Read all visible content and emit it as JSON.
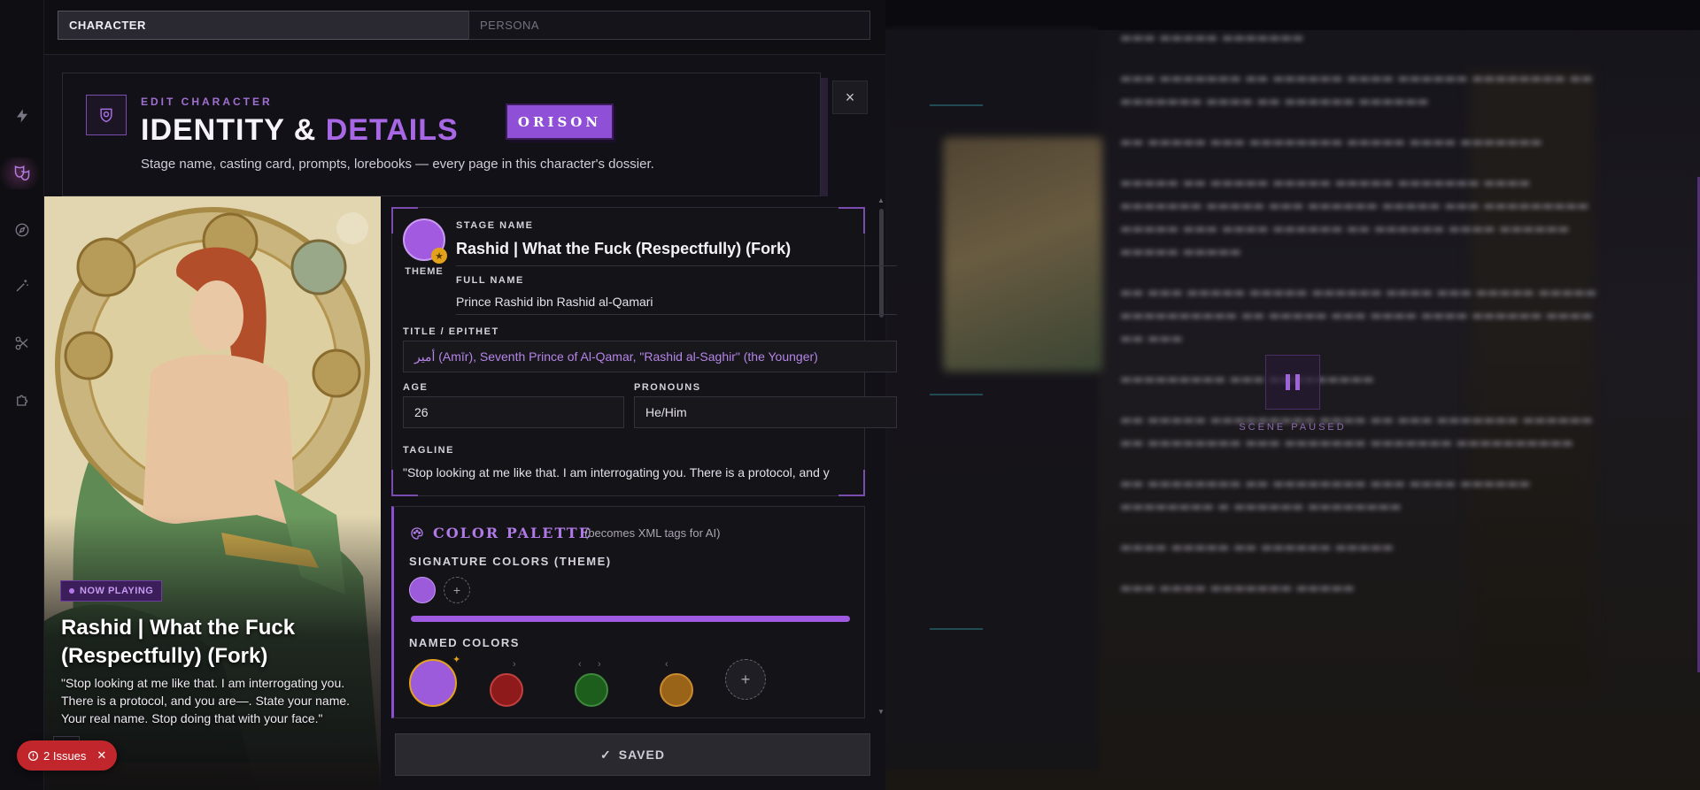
{
  "tabs": [
    {
      "label": "CHARACTER",
      "active": true
    },
    {
      "label": "PERSONA",
      "active": false
    }
  ],
  "header": {
    "kicker": "EDIT CHARACTER",
    "title_main": "IDENTITY &",
    "title_accent": "DETAILS",
    "badge": "ORISON",
    "subtitle": "Stage name, casting card, prompts, lorebooks — every page in this character's dossier.",
    "close_label": "×"
  },
  "rail": {
    "icons": [
      "lightning-icon",
      "theater-masks-icon",
      "compass-icon",
      "magic-wand-icon",
      "scissors-icon",
      "puzzle-icon"
    ],
    "active": "theater-masks-icon"
  },
  "portrait": {
    "now_playing": "NOW PLAYING",
    "name": "Rashid | What the Fuck (Respectfully) (Fork)",
    "quote": "\"Stop looking at me like that. I am interrogating you. There is a protocol, and you are—. State your name. Your real name. Stop doing that with your face.\""
  },
  "identity": {
    "theme_label": "THEME",
    "stage_name_label": "STAGE NAME",
    "stage_name": "Rashid | What the Fuck (Respectfully) (Fork)",
    "full_name_label": "FULL NAME",
    "full_name": "Prince Rashid ibn Rashid al-Qamari",
    "title_label": "TITLE / EPITHET",
    "title_value": "أمير (Amīr), Seventh Prince of Al-Qamar, \"Rashid al-Saghir\" (the Younger)",
    "age_label": "AGE",
    "age": "26",
    "pronouns_label": "PRONOUNS",
    "pronouns": "He/Him",
    "tagline_label": "TAGLINE",
    "tagline": "\"Stop looking at me like that. I am interrogating you. There is a protocol, and y"
  },
  "palette": {
    "title": "COLOR PALETTE",
    "subtitle": "(becomes XML tags for AI)",
    "signature_label": "SIGNATURE COLORS (THEME)",
    "named_label": "NAMED COLORS",
    "signature_colors": [
      "#9b5bdb"
    ],
    "named_colors": [
      "#9b5bdb",
      "#8e1a1c",
      "#1d5e1d",
      "#9a6418"
    ],
    "add_label": "+"
  },
  "footer": {
    "saved_label": "SAVED",
    "issues_label": "2 Issues"
  },
  "scene": {
    "paused_label": "SCENE PAUSED"
  },
  "colors": {
    "accent": "#a868e6",
    "danger": "#c0262c"
  }
}
